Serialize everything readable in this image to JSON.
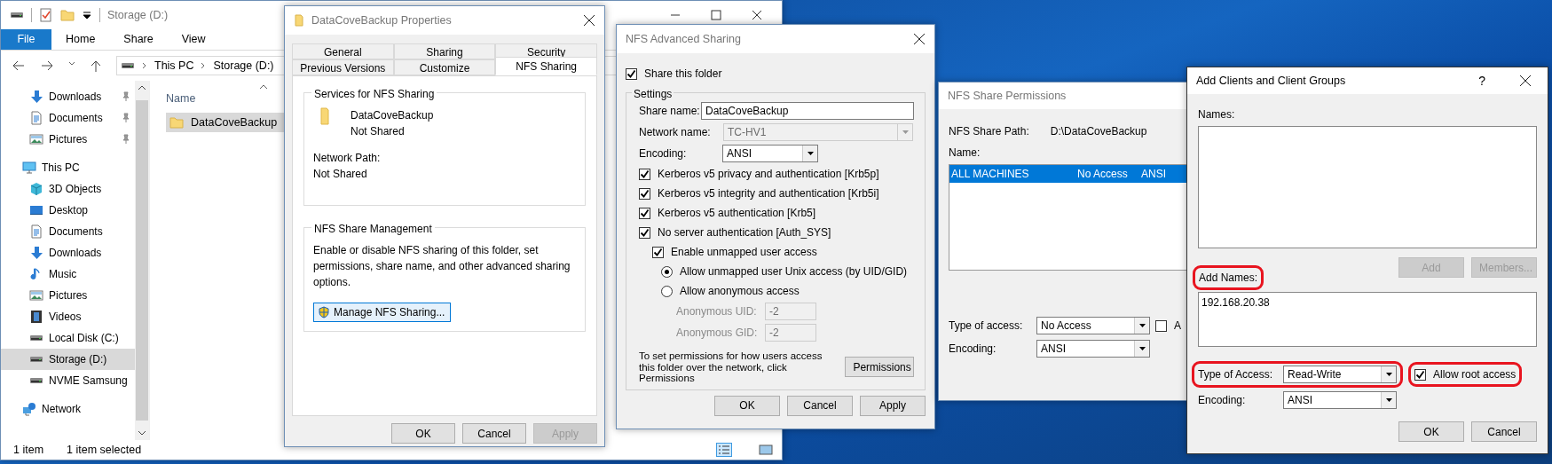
{
  "explorer": {
    "title": "Storage (D:)",
    "file_menu": "File",
    "ribbon_tabs": [
      "Home",
      "Share",
      "View"
    ],
    "breadcrumb": [
      "This PC",
      "Storage (D:)"
    ],
    "quick_access": [
      {
        "label": "Downloads",
        "kind": "download",
        "pinned": true
      },
      {
        "label": "Documents",
        "kind": "document",
        "pinned": true
      },
      {
        "label": "Pictures",
        "kind": "picture",
        "pinned": true
      }
    ],
    "nav_tree": [
      {
        "label": "This PC",
        "kind": "pc",
        "selected": false,
        "children": [
          {
            "label": "3D Objects",
            "kind": "cube",
            "selected": false
          },
          {
            "label": "Desktop",
            "kind": "desktop",
            "selected": false
          },
          {
            "label": "Documents",
            "kind": "document",
            "selected": false
          },
          {
            "label": "Downloads",
            "kind": "download",
            "selected": false
          },
          {
            "label": "Music",
            "kind": "music",
            "selected": false
          },
          {
            "label": "Pictures",
            "kind": "picture",
            "selected": false
          },
          {
            "label": "Videos",
            "kind": "video",
            "selected": false
          },
          {
            "label": "Local Disk (C:)",
            "kind": "disk",
            "selected": false
          },
          {
            "label": "Storage (D:)",
            "kind": "disk",
            "selected": true
          },
          {
            "label": "NVME Samsung",
            "kind": "disk",
            "selected": false
          }
        ]
      },
      {
        "label": "Network",
        "kind": "network",
        "selected": false
      }
    ],
    "column_header": "Name",
    "files": [
      {
        "name": "DataCoveBackup",
        "selected": true
      }
    ],
    "status_bar": [
      "1 item",
      "1 item selected"
    ]
  },
  "properties": {
    "title": "DataCoveBackup Properties",
    "tab_rows": [
      [
        {
          "label": "General",
          "selected": false
        },
        {
          "label": "Sharing",
          "selected": false
        },
        {
          "label": "Security",
          "selected": false
        }
      ],
      [
        {
          "label": "Previous Versions",
          "selected": false
        },
        {
          "label": "Customize",
          "selected": false
        },
        {
          "label": "NFS Sharing",
          "selected": true
        }
      ]
    ],
    "services_group": {
      "legend": "Services for NFS Sharing",
      "folder_name": "DataCoveBackup",
      "share_status": "Not Shared",
      "network_path_label": "Network Path:",
      "network_path": "Not Shared"
    },
    "management_group": {
      "legend": "NFS Share Management",
      "description": "Enable or disable NFS sharing of this folder, set permissions, share name, and other advanced sharing options.",
      "button": "Manage NFS Sharing..."
    },
    "buttons": [
      {
        "label": "OK",
        "disabled": false
      },
      {
        "label": "Cancel",
        "disabled": false
      },
      {
        "label": "Apply",
        "disabled": true
      }
    ]
  },
  "advanced": {
    "title": "NFS Advanced Sharing",
    "share_folder": {
      "label": "Share this folder",
      "checked": true
    },
    "settings_legend": "Settings",
    "share_name": {
      "label": "Share name:",
      "value": "DataCoveBackup"
    },
    "network_name": {
      "label": "Network name:",
      "value": "TC-HV1",
      "disabled": true
    },
    "encoding": {
      "label": "Encoding:",
      "value": "ANSI"
    },
    "options": [
      {
        "kind": "checkbox",
        "label": "Kerberos v5 privacy and authentication [Krb5p]",
        "checked": true
      },
      {
        "kind": "checkbox",
        "label": "Kerberos v5 integrity and authentication [Krb5i]",
        "checked": true
      },
      {
        "kind": "checkbox",
        "label": "Kerberos v5 authentication [Krb5]",
        "checked": true
      },
      {
        "kind": "checkbox",
        "label": "No server authentication [Auth_SYS]",
        "checked": true,
        "children": [
          {
            "kind": "checkbox",
            "label": "Enable unmapped user access",
            "checked": true,
            "children": [
              {
                "kind": "radio",
                "label": "Allow unmapped user Unix access (by UID/GID)",
                "selected": true
              },
              {
                "kind": "radio",
                "label": "Allow anonymous access",
                "selected": false
              }
            ]
          }
        ]
      }
    ],
    "anonymous_fields": [
      {
        "label": "Anonymous UID:",
        "value": "-2",
        "disabled": true
      },
      {
        "label": "Anonymous GID:",
        "value": "-2",
        "disabled": true
      }
    ],
    "permissions_text": "To set permissions for how users access this folder over the network, click Permissions",
    "permissions_button": "Permissions",
    "buttons": [
      {
        "label": "OK",
        "disabled": false
      },
      {
        "label": "Cancel",
        "disabled": false
      },
      {
        "label": "Apply",
        "disabled": false
      }
    ]
  },
  "permissions": {
    "title": "NFS Share Permissions",
    "path_label": "NFS Share Path:",
    "path": "D:\\DataCoveBackup",
    "name_label": "Name:",
    "rows": [
      {
        "cells": [
          "ALL MACHINES",
          "No Access",
          "ANSI"
        ],
        "selected": true
      }
    ],
    "type_label": "Type of access:",
    "type_value": "No Access",
    "encoding_label": "Encoding:",
    "encoding_value": "ANSI",
    "cut_checkbox": {
      "label": "A",
      "checked": false
    }
  },
  "add_clients": {
    "title": "Add Clients and Client Groups",
    "help": "?",
    "names_label": "Names:",
    "list_buttons": [
      {
        "label": "Add",
        "disabled": true
      },
      {
        "label": "Members...",
        "disabled": true
      }
    ],
    "add_names": {
      "label": "Add Names:",
      "value": "192.168.20.38",
      "highlighted": true
    },
    "type_of_access": {
      "label": "Type of Access:",
      "value": "Read-Write",
      "highlighted": true
    },
    "root_access": {
      "label": "Allow root access",
      "checked": true,
      "highlighted": true
    },
    "encoding": {
      "label": "Encoding:",
      "value": "ANSI"
    },
    "buttons": [
      {
        "label": "OK",
        "disabled": false
      },
      {
        "label": "Cancel",
        "disabled": false
      }
    ]
  }
}
